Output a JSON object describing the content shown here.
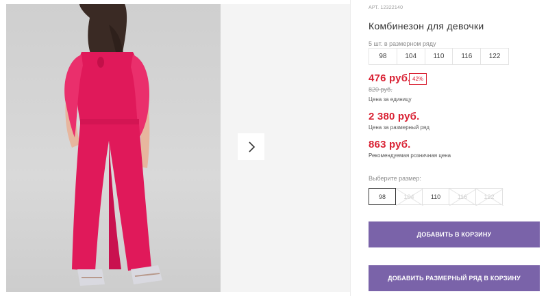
{
  "product": {
    "sku": "АРТ. 12322140",
    "title": "Комбинезон для девочки",
    "row_label": "5 шт. в размерном ряду",
    "row_sizes": [
      "98",
      "104",
      "110",
      "116",
      "122"
    ]
  },
  "pricing": {
    "unit_price": "476 руб.",
    "discount": "42%",
    "old_price": "820 руб.",
    "unit_caption": "Цена за единицу",
    "row_price": "2 380 руб.",
    "row_caption": "Цена за размерный ряд",
    "rrp_price": "863 руб.",
    "rrp_caption": "Рекомендуемая розничная цена"
  },
  "size_picker": {
    "label": "Выберите размер:",
    "options": [
      {
        "label": "98",
        "state": "selected"
      },
      {
        "label": "104",
        "state": "disabled"
      },
      {
        "label": "110",
        "state": "available"
      },
      {
        "label": "116",
        "state": "disabled"
      },
      {
        "label": "122",
        "state": "disabled"
      }
    ]
  },
  "actions": {
    "add_to_cart": "ДОБАВИТЬ В КОРЗИНУ",
    "add_row_to_cart": "ДОБАВИТЬ РАЗМЕРНЫЙ РЯД В КОРЗИНУ"
  },
  "colors": {
    "accent_purple": "#7a63a9",
    "price_red": "#d92133",
    "garment": "#e0195a"
  },
  "icons": {
    "gallery_next": "chevron-right-icon"
  }
}
